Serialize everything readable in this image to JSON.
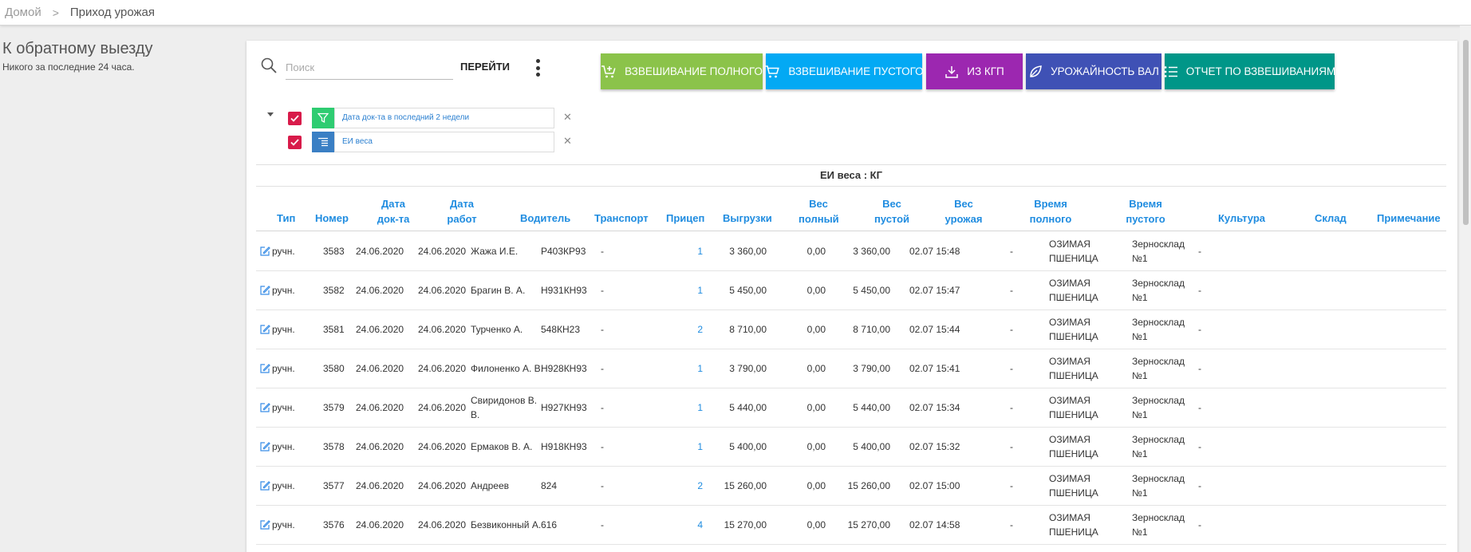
{
  "breadcrumb": {
    "home": "Домой",
    "separator": ">",
    "current": "Приход урожая"
  },
  "sidebar": {
    "title": "К обратному выезду",
    "subtitle": "Никого за последние 24 часа."
  },
  "toolbar": {
    "search_placeholder": "Поиск",
    "search_value": "",
    "go_label": "ПЕРЕЙТИ",
    "more_icon": "more-vertical-icon"
  },
  "actions": [
    {
      "label": "ВЗВЕШИВАНИЕ ПОЛНОГО",
      "icon": "cart-add-icon",
      "color": "#8bc34a"
    },
    {
      "label": "ВЗВЕШИВАНИЕ ПУСТОГО",
      "icon": "cart-icon",
      "color": "#03a9f4"
    },
    {
      "label": "ИЗ КГП",
      "icon": "download-icon",
      "color": "#9c27b0"
    },
    {
      "label": "УРОЖАЙНОСТЬ ВАЛ",
      "icon": "leaf-icon",
      "color": "#3f51b5"
    },
    {
      "label": "ОТЧЕТ ПО ВЗВЕШИВАНИЯМ",
      "icon": "list-icon",
      "color": "#009688"
    }
  ],
  "filters": [
    {
      "label": "Дата док-та в последний 2 недели",
      "icon": "filter-icon",
      "icon_color": "#2ecc71",
      "checked": true
    },
    {
      "label": "ЕИ веса",
      "icon": "group-icon",
      "icon_color": "#3a7fc4",
      "checked": true
    }
  ],
  "group_label": "ЕИ веса : КГ",
  "columns": [
    "Тип",
    "Номер",
    "Дата док-та",
    "Дата работ",
    "Водитель",
    "Транспорт",
    "Прицеп",
    "Выгрузки",
    "Вес полный",
    "Вес пустой",
    "Вес урожая",
    "Время полного",
    "Время пустого",
    "Культура",
    "Склад",
    "Примечание"
  ],
  "rows": [
    {
      "type": "ручн.",
      "number": "3583",
      "doc_date": "24.06.2020",
      "work_date": "24.06.2020",
      "driver": "Жажа И.Е.",
      "transport": "Р403КР93",
      "trailer": "-",
      "unloads": "1",
      "weight_full": "3 360,00",
      "weight_empty": "0,00",
      "weight_crop": "3 360,00",
      "time_full": "02.07 15:48",
      "time_empty": "-",
      "crop": "ОЗИМАЯ ПШЕНИЦА",
      "warehouse": "Зерносклад №1",
      "note": "-"
    },
    {
      "type": "ручн.",
      "number": "3582",
      "doc_date": "24.06.2020",
      "work_date": "24.06.2020",
      "driver": "Брагин В. А.",
      "transport": "Н931КН93",
      "trailer": "-",
      "unloads": "1",
      "weight_full": "5 450,00",
      "weight_empty": "0,00",
      "weight_crop": "5 450,00",
      "time_full": "02.07 15:47",
      "time_empty": "-",
      "crop": "ОЗИМАЯ ПШЕНИЦА",
      "warehouse": "Зерносклад №1",
      "note": "-"
    },
    {
      "type": "ручн.",
      "number": "3581",
      "doc_date": "24.06.2020",
      "work_date": "24.06.2020",
      "driver": "Турченко А.",
      "transport": "548КН23",
      "trailer": "-",
      "unloads": "2",
      "weight_full": "8 710,00",
      "weight_empty": "0,00",
      "weight_crop": "8 710,00",
      "time_full": "02.07 15:44",
      "time_empty": "-",
      "crop": "ОЗИМАЯ ПШЕНИЦА",
      "warehouse": "Зерносклад №1",
      "note": "-"
    },
    {
      "type": "ручн.",
      "number": "3580",
      "doc_date": "24.06.2020",
      "work_date": "24.06.2020",
      "driver": "Филоненко А. В.",
      "transport": "Н928КН93",
      "trailer": "-",
      "unloads": "1",
      "weight_full": "3 790,00",
      "weight_empty": "0,00",
      "weight_crop": "3 790,00",
      "time_full": "02.07 15:41",
      "time_empty": "-",
      "crop": "ОЗИМАЯ ПШЕНИЦА",
      "warehouse": "Зерносклад №1",
      "note": "-"
    },
    {
      "type": "ручн.",
      "number": "3579",
      "doc_date": "24.06.2020",
      "work_date": "24.06.2020",
      "driver": "Свиридонов В. В.",
      "transport": "Н927КН93",
      "trailer": "-",
      "unloads": "1",
      "weight_full": "5 440,00",
      "weight_empty": "0,00",
      "weight_crop": "5 440,00",
      "time_full": "02.07 15:34",
      "time_empty": "-",
      "crop": "ОЗИМАЯ ПШЕНИЦА",
      "warehouse": "Зерносклад №1",
      "note": "-"
    },
    {
      "type": "ручн.",
      "number": "3578",
      "doc_date": "24.06.2020",
      "work_date": "24.06.2020",
      "driver": "Ермаков В. А.",
      "transport": "Н918КН93",
      "trailer": "-",
      "unloads": "1",
      "weight_full": "5 400,00",
      "weight_empty": "0,00",
      "weight_crop": "5 400,00",
      "time_full": "02.07 15:32",
      "time_empty": "-",
      "crop": "ОЗИМАЯ ПШЕНИЦА",
      "warehouse": "Зерносклад №1",
      "note": "-"
    },
    {
      "type": "ручн.",
      "number": "3577",
      "doc_date": "24.06.2020",
      "work_date": "24.06.2020",
      "driver": "Андреев",
      "transport": "824",
      "trailer": "-",
      "unloads": "2",
      "weight_full": "15 260,00",
      "weight_empty": "0,00",
      "weight_crop": "15 260,00",
      "time_full": "02.07 15:00",
      "time_empty": "-",
      "crop": "ОЗИМАЯ ПШЕНИЦА",
      "warehouse": "Зерносклад №1",
      "note": "-"
    },
    {
      "type": "ручн.",
      "number": "3576",
      "doc_date": "24.06.2020",
      "work_date": "24.06.2020",
      "driver": "Безвиконный А.",
      "transport": "616",
      "trailer": "-",
      "unloads": "4",
      "weight_full": "15 270,00",
      "weight_empty": "0,00",
      "weight_crop": "15 270,00",
      "time_full": "02.07 14:58",
      "time_empty": "-",
      "crop": "ОЗИМАЯ ПШЕНИЦА",
      "warehouse": "Зерносклад №1",
      "note": "-"
    }
  ]
}
